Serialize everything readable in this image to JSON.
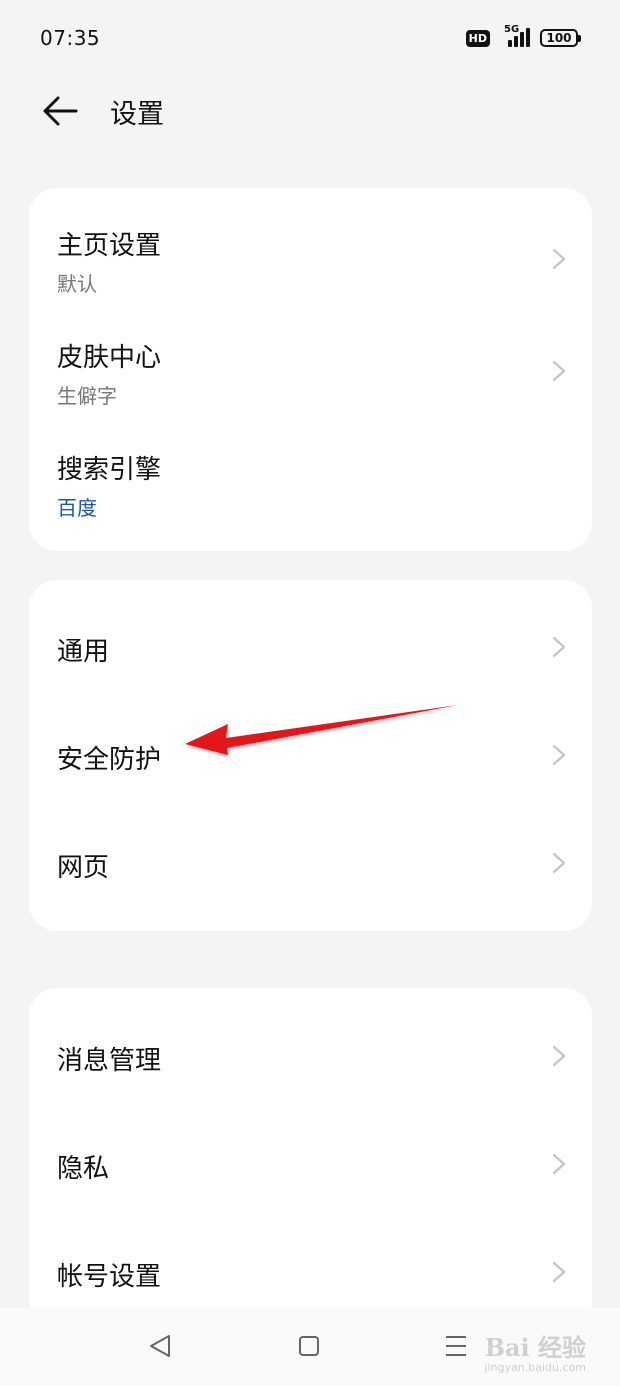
{
  "status_bar": {
    "time": "07:35",
    "hd_label": "HD",
    "network_label": "5G",
    "battery_level": "100"
  },
  "header": {
    "back_icon": "arrow-left-icon",
    "title": "设置"
  },
  "groups": [
    {
      "items": [
        {
          "title": "主页设置",
          "subtitle": "默认"
        },
        {
          "title": "皮肤中心",
          "subtitle": "生僻字"
        },
        {
          "title": "搜索引擎",
          "subtitle": "百度"
        }
      ]
    },
    {
      "items": [
        {
          "title": "通用"
        },
        {
          "title": "安全防护"
        },
        {
          "title": "网页"
        }
      ]
    },
    {
      "items": [
        {
          "title": "消息管理"
        },
        {
          "title": "隐私"
        },
        {
          "title": "帐号设置"
        }
      ]
    }
  ],
  "nav_bar": {
    "back_icon": "triangle-back-icon",
    "home_icon": "square-home-icon",
    "menu_icon": "menu-lines-icon"
  },
  "watermark": {
    "main": "Bai 经验",
    "url": "jingyan.baidu.com"
  },
  "colors": {
    "background": "#f4f4f4",
    "card": "#ffffff",
    "subtitle_accent": "#2255aa",
    "annotation_arrow": "#e3141b"
  }
}
